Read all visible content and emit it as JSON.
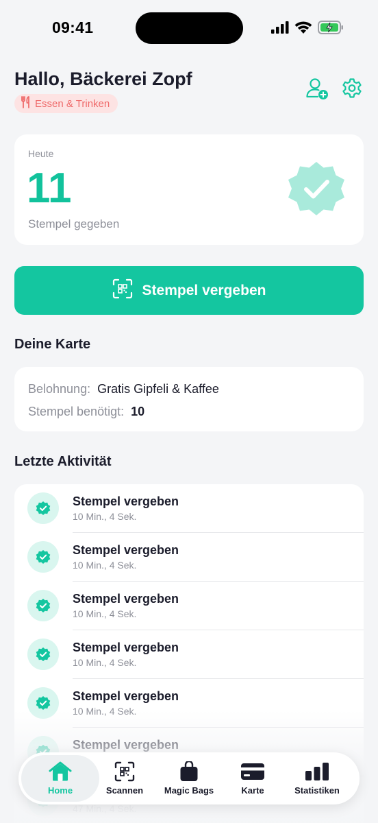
{
  "status_bar": {
    "time": "09:41"
  },
  "header": {
    "greeting": "Hallo, Bäckerei Zopf",
    "category": "Essen & Trinken"
  },
  "today": {
    "label": "Heute",
    "count": "11",
    "subtitle": "Stempel gegeben"
  },
  "primary_action": {
    "label": "Stempel vergeben"
  },
  "card_section": {
    "title": "Deine Karte",
    "reward_key": "Belohnung:",
    "reward_value": "Gratis Gipfeli & Kaffee",
    "stamps_key": "Stempel benötigt:",
    "stamps_value": "10"
  },
  "activity": {
    "title": "Letzte Aktivität",
    "items": [
      {
        "title": "Stempel vergeben",
        "time": "10 Min., 4 Sek."
      },
      {
        "title": "Stempel vergeben",
        "time": "10 Min., 4 Sek."
      },
      {
        "title": "Stempel vergeben",
        "time": "10 Min., 4 Sek."
      },
      {
        "title": "Stempel vergeben",
        "time": "10 Min., 4 Sek."
      },
      {
        "title": "Stempel vergeben",
        "time": "10 Min., 4 Sek."
      },
      {
        "title": "Stempel vergeben",
        "time": ""
      },
      {
        "title": "",
        "time": "47 Min., 4 Sek."
      }
    ]
  },
  "tabs": [
    {
      "label": "Home",
      "icon": "home-icon",
      "active": true
    },
    {
      "label": "Scannen",
      "icon": "qr-scan-icon"
    },
    {
      "label": "Magic Bags",
      "icon": "bag-icon"
    },
    {
      "label": "Karte",
      "icon": "card-icon"
    },
    {
      "label": "Statistiken",
      "icon": "bar-chart-icon"
    }
  ],
  "colors": {
    "accent": "#14c6a0",
    "accent_light": "#d9f6ef",
    "badge_bg": "#fde3e3",
    "badge_text": "#ef6b6b",
    "background": "#f4f5f7"
  }
}
